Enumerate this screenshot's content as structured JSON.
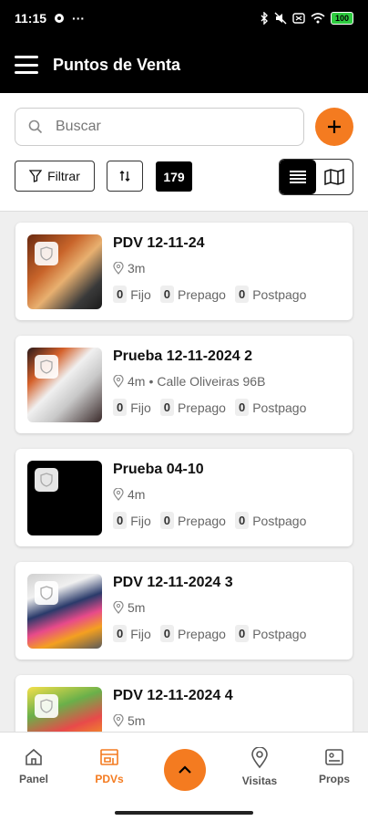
{
  "status_bar": {
    "time": "11:15",
    "battery": "100"
  },
  "header": {
    "title": "Puntos de Venta"
  },
  "search": {
    "placeholder": "Buscar"
  },
  "toolbar": {
    "filter_label": "Filtrar",
    "count": "179"
  },
  "accent_color": "#f47b20",
  "cards": [
    {
      "title": "PDV 12-11-24",
      "distance": "3m",
      "address": "",
      "fijo": "0",
      "prepago": "0",
      "postpago": "0"
    },
    {
      "title": "Prueba 12-11-2024 2",
      "distance": "4m",
      "address": "Calle Oliveiras 96B",
      "fijo": "0",
      "prepago": "0",
      "postpago": "0"
    },
    {
      "title": "Prueba 04-10",
      "distance": "4m",
      "address": "",
      "fijo": "0",
      "prepago": "0",
      "postpago": "0"
    },
    {
      "title": "PDV 12-11-2024 3",
      "distance": "5m",
      "address": "",
      "fijo": "0",
      "prepago": "0",
      "postpago": "0"
    },
    {
      "title": "PDV 12-11-2024 4",
      "distance": "5m",
      "address": "",
      "fijo": "",
      "prepago": "",
      "postpago": ""
    }
  ],
  "labels": {
    "fijo": "Fijo",
    "prepago": "Prepago",
    "postpago": "Postpago",
    "separator": "•"
  },
  "bottom_nav": [
    {
      "label": "Panel",
      "icon": "home-icon"
    },
    {
      "label": "PDVs",
      "icon": "store-icon"
    },
    {
      "label": "Visitas",
      "icon": "location-pin-icon"
    },
    {
      "label": "Props",
      "icon": "props-icon"
    }
  ]
}
